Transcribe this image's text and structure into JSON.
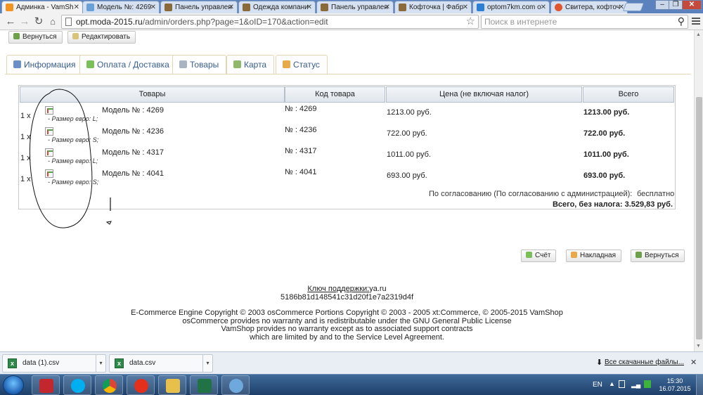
{
  "browser": {
    "tabs": [
      {
        "title": "Админка - VamSh",
        "active": true,
        "color": "#f29423"
      },
      {
        "title": "Модель №: 4269",
        "active": false,
        "color": "#6aa0d8"
      },
      {
        "title": "Панель управлен",
        "active": false,
        "color": "#8a6a3a"
      },
      {
        "title": "Одежда компани",
        "active": false,
        "color": "#8a6a3a"
      },
      {
        "title": "Панель управлен",
        "active": false,
        "color": "#8a6a3a"
      },
      {
        "title": "Кофточка | Фабр",
        "active": false,
        "color": "#8a6a3a"
      },
      {
        "title": "optom7km.com о",
        "active": false,
        "color": "#2d7fd3"
      },
      {
        "title": "Свитера, кофточ",
        "active": false,
        "color": "#e0562e"
      }
    ],
    "url_host": "opt.moda-2015.ru",
    "url_path": "/admin/orders.php?page=1&oID=170&action=edit",
    "search_placeholder": "Поиск в интернете"
  },
  "top_buttons": {
    "back": "Вернуться",
    "edit": "Редактировать"
  },
  "page_tabs": [
    {
      "label": "Информация",
      "icon": "info-icon",
      "color": "#6b8fc7"
    },
    {
      "label": "Оплата / Доставка",
      "icon": "payment-icon",
      "color": "#7bbf5a"
    },
    {
      "label": "Товары",
      "icon": "products-icon",
      "color": "#a9b4c2"
    },
    {
      "label": "Карта",
      "icon": "map-icon",
      "color": "#8fb86a"
    },
    {
      "label": "Статус",
      "icon": "status-icon",
      "color": "#e8a94a"
    }
  ],
  "products_table": {
    "headers": [
      "Товары",
      "Код товара",
      "Цена (не включая налог)",
      "Всего"
    ],
    "rows": [
      {
        "qty": "1 x",
        "size": "- Размер евро: L;",
        "model": "Модель № : 4269",
        "code": "№ : 4269",
        "price": "1213.00 руб.",
        "total": "1213.00 руб."
      },
      {
        "qty": "1 x",
        "size": "- Размер евро: S;",
        "model": "Модель № : 4236",
        "code": "№ : 4236",
        "price": "722.00 руб.",
        "total": "722.00 руб."
      },
      {
        "qty": "1 x",
        "size": "- Размер евро: L;",
        "model": "Модель № : 4317",
        "code": "№ : 4317",
        "price": "1011.00 руб.",
        "total": "1011.00 руб."
      },
      {
        "qty": "1 x",
        "size": "- Размер евро: S;",
        "model": "Модель № : 4041",
        "code": "№ : 4041",
        "price": "693.00 руб.",
        "total": "693.00 руб."
      }
    ],
    "shipping_label": "По согласованию (По согласованию с администрацией):",
    "shipping_value": "бесплатно",
    "grand_total": "Всего, без налога: 3.529,83 руб."
  },
  "bottom_buttons": {
    "invoice": "Счёт",
    "packing": "Накладная",
    "back": "Вернуться"
  },
  "support": {
    "key_label": "Ключ поддержки:",
    "key_domain": "ya.ru",
    "key_hash": "5186b81d148541c31d20f1e7a2319d4f",
    "copyright_lines": [
      "E-Commerce Engine Copyright © 2003 osCommerce Portions Copyright © 2003 - 2005 xt:Commerce, © 2005-2015 VamShop",
      "osCommerce provides no warranty and is redistributable under the GNU General Public License",
      "VamShop provides no warranty except as to associated support contracts",
      "which are limited by and to the Service Level Agreement."
    ]
  },
  "downloads": {
    "items": [
      "data (1).csv",
      "data.csv"
    ],
    "all_label": "Все скачанные файлы..."
  },
  "taskbar": {
    "apps": [
      {
        "name": "filezilla-icon",
        "color": "#c1272d"
      },
      {
        "name": "skype-icon",
        "color": "#00aff0"
      },
      {
        "name": "chrome-icon",
        "color": "#3c9a3c"
      },
      {
        "name": "yandex-browser-icon",
        "color": "#e3301c"
      },
      {
        "name": "folder-icon",
        "color": "#e6c04a"
      },
      {
        "name": "excel-icon",
        "color": "#217346"
      },
      {
        "name": "paint-icon",
        "color": "#6fa8dc"
      }
    ],
    "lang": "EN",
    "time": "15:30",
    "date": "16.07.2015"
  }
}
